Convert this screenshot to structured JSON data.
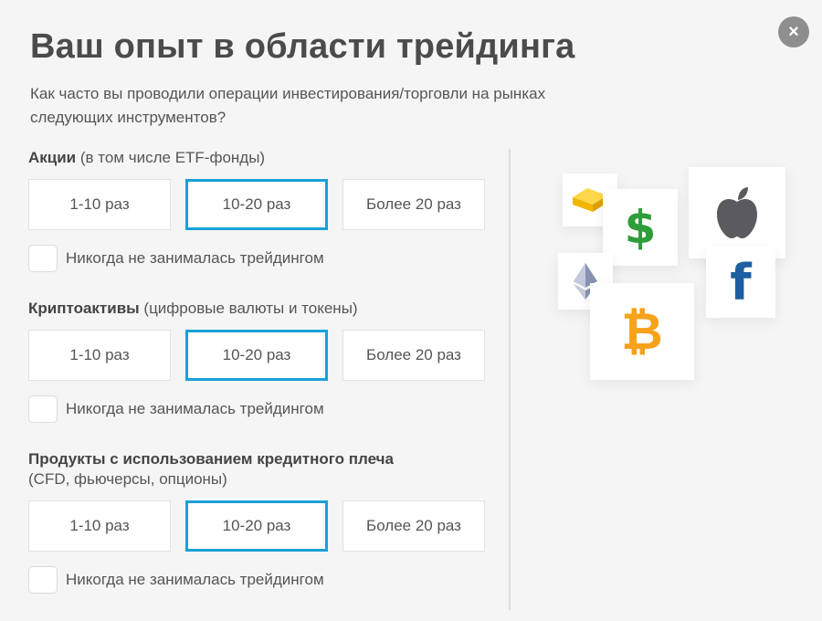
{
  "dialog": {
    "close_label": "×",
    "title": "Ваш опыт в области трейдинга",
    "subtitle": "Как часто вы проводили операции инвестирования/торговли на рынках следующих инструментов?"
  },
  "sections": [
    {
      "title_bold": "Акции",
      "title_note": " (в том числе ETF-фонды)",
      "options": [
        "1-10 раз",
        "10-20 раз",
        "Более 20 раз"
      ],
      "selected": "10-20 раз",
      "never_label": "Никогда не занималась трейдингом"
    },
    {
      "title_bold": "Криптоактивы",
      "title_note": " (цифровые валюты и токены)",
      "options": [
        "1-10 раз",
        "10-20 раз",
        "Более 20 раз"
      ],
      "selected": "10-20 раз",
      "never_label": "Никогда не занималась трейдингом"
    },
    {
      "title_bold": "Продукты с использованием кредитного плеча",
      "title_note": "(CFD, фьючерсы, опционы)",
      "options": [
        "1-10 раз",
        "10-20 раз",
        "Более 20 раз"
      ],
      "selected": "10-20 раз",
      "never_label": "Никогда не занималась трейдингом"
    }
  ],
  "illustration": {
    "icons": [
      "gold-bar-icon",
      "dollar-icon",
      "apple-icon",
      "ethereum-icon",
      "facebook-icon",
      "bitcoin-icon"
    ],
    "dollar_glyph": "$",
    "bitcoin_glyph": "₿",
    "facebook_glyph": "f"
  },
  "colors": {
    "accent": "#1aa0d8",
    "dollar": "#2e9d3a",
    "bitcoin": "#f7a21b",
    "facebook": "#1d5fa0",
    "apple": "#5a5a5f",
    "gold": "#f5c400"
  }
}
